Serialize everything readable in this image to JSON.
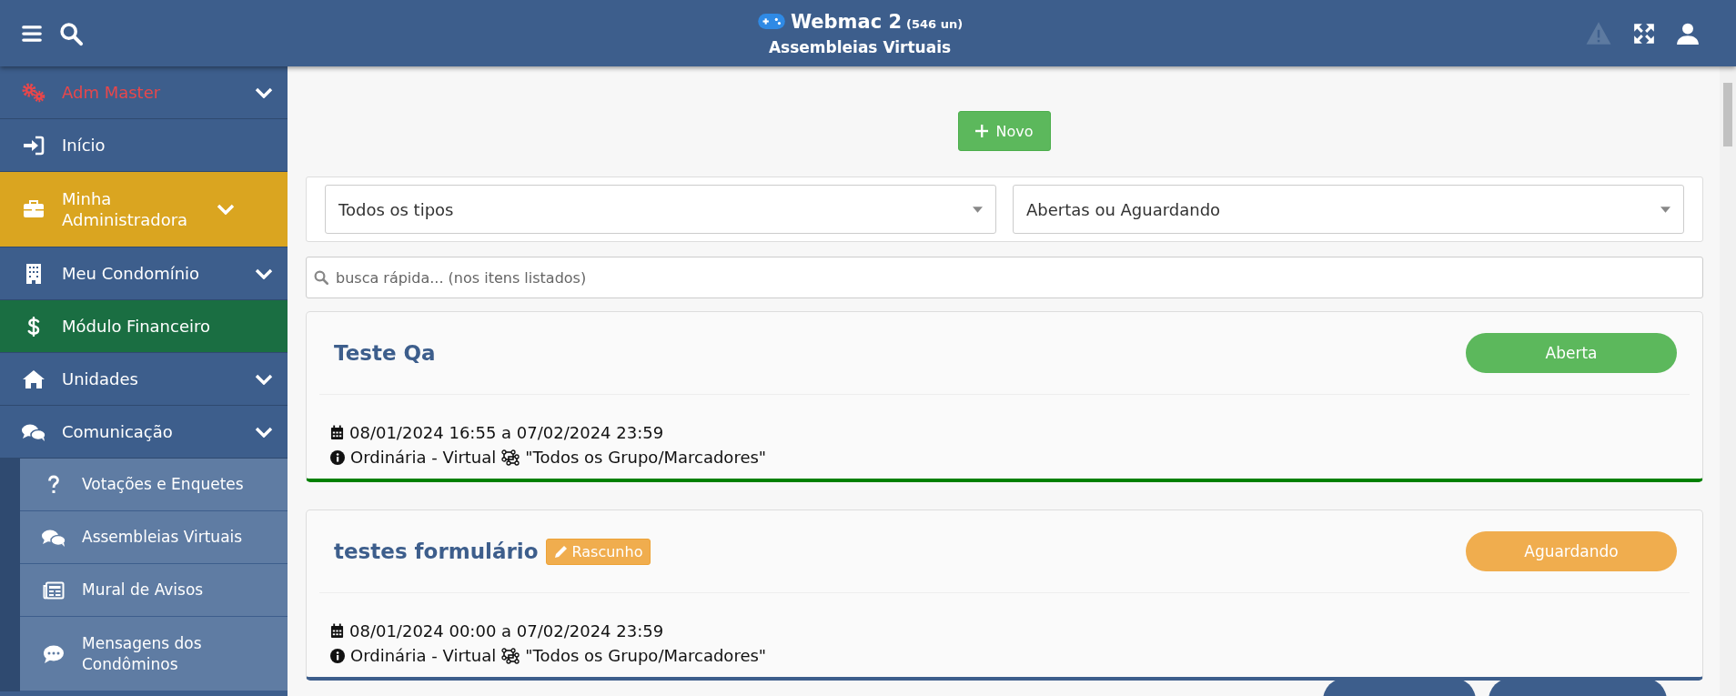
{
  "header": {
    "title": "Webmac 2",
    "count": "(546 un)",
    "subtitle": "Assembleias Virtuais"
  },
  "sidebar": {
    "items": [
      {
        "label": "Adm Master",
        "kind": "master",
        "expandable": true
      },
      {
        "label": "Início",
        "kind": "normal",
        "expandable": false
      },
      {
        "label": "Minha Administradora",
        "kind": "normal",
        "expandable": true,
        "color": "#daa520"
      },
      {
        "label": "Meu Condomínio",
        "kind": "normal",
        "expandable": true
      },
      {
        "label": "Módulo Financeiro",
        "kind": "normal",
        "expandable": false,
        "color": "#1a6e42"
      },
      {
        "label": "Unidades",
        "kind": "normal",
        "expandable": true
      },
      {
        "label": "Comunicação",
        "kind": "normal",
        "expandable": true,
        "children": [
          {
            "label": "Votações e Enquetes"
          },
          {
            "label": "Assembleias Virtuais"
          },
          {
            "label": "Mural de Avisos"
          },
          {
            "label": "Mensagens dos Condôminos"
          }
        ]
      }
    ]
  },
  "new_button": "Novo",
  "filters": [
    {
      "value": "Todos os tipos"
    },
    {
      "value": "Abertas ou Aguardando"
    }
  ],
  "search": {
    "placeholder": "busca rápida... (nos itens listados)"
  },
  "cards": [
    {
      "title": "Teste Qa",
      "status": {
        "label": "Aberta",
        "color": "#5cb85c"
      },
      "color": "#008000",
      "dates": "08/01/2024 16:55 a 07/02/2024 23:59",
      "type": "Ordinária - Virtual",
      "groups": "\"Todos os Grupo/Marcadores\""
    },
    {
      "title": "testes formulário",
      "draft": "Rascunho",
      "status": {
        "label": "Aguardando",
        "color": "#f0ad4e"
      },
      "color": "#3d5e8c",
      "dates": "08/01/2024 00:00 a 07/02/2024 23:59",
      "type": "Ordinária - Virtual",
      "groups": "\"Todos os Grupo/Marcadores\""
    }
  ]
}
